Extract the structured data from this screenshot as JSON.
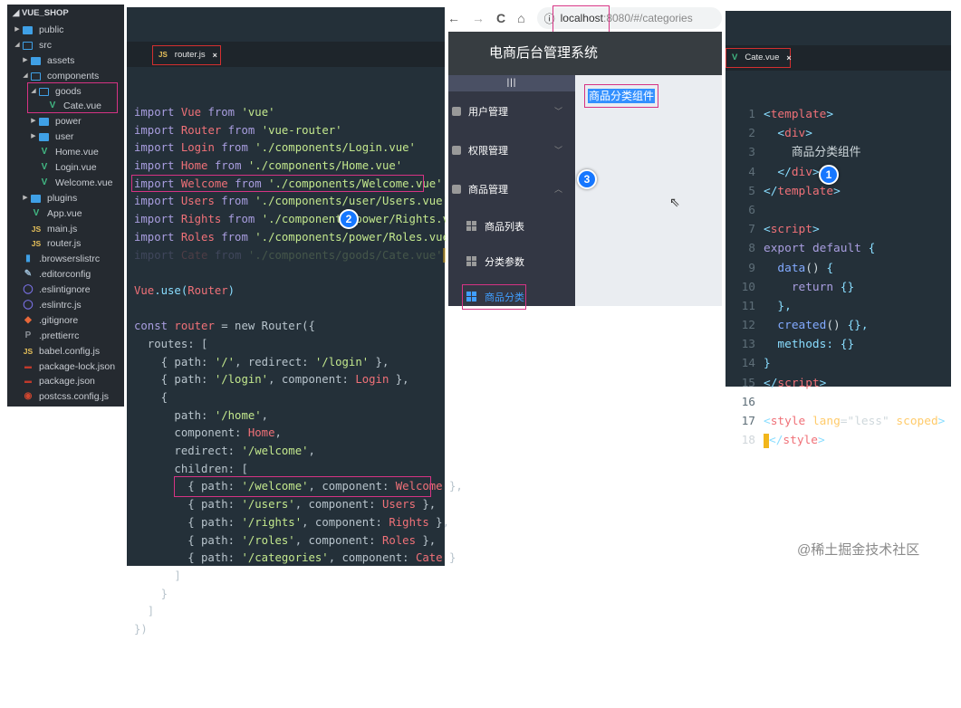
{
  "explorer": {
    "title": "VUE_SHOP",
    "items": [
      {
        "label": "public",
        "icon": "folder",
        "level": 1,
        "arrow": "▶"
      },
      {
        "label": "src",
        "icon": "folder-open",
        "level": 1,
        "arrow": "◢"
      },
      {
        "label": "assets",
        "icon": "folder",
        "level": 2,
        "arrow": "▶"
      },
      {
        "label": "components",
        "icon": "folder-open",
        "level": 2,
        "arrow": "◢"
      },
      {
        "label": "goods",
        "icon": "folder-open",
        "level": 3,
        "arrow": "◢"
      },
      {
        "label": "Cate.vue",
        "icon": "vue",
        "level": 4,
        "arrow": ""
      },
      {
        "label": "power",
        "icon": "folder",
        "level": 3,
        "arrow": "▶"
      },
      {
        "label": "user",
        "icon": "folder",
        "level": 3,
        "arrow": "▶"
      },
      {
        "label": "Home.vue",
        "icon": "vue",
        "level": 3,
        "arrow": ""
      },
      {
        "label": "Login.vue",
        "icon": "vue",
        "level": 3,
        "arrow": ""
      },
      {
        "label": "Welcome.vue",
        "icon": "vue",
        "level": 3,
        "arrow": ""
      },
      {
        "label": "plugins",
        "icon": "folder",
        "level": 2,
        "arrow": "▶"
      },
      {
        "label": "App.vue",
        "icon": "vue",
        "level": 2,
        "arrow": ""
      },
      {
        "label": "main.js",
        "icon": "js",
        "level": 2,
        "arrow": ""
      },
      {
        "label": "router.js",
        "icon": "js",
        "level": 2,
        "arrow": ""
      },
      {
        "label": ".browserslistrc",
        "icon": "file",
        "level": 1,
        "arrow": ""
      },
      {
        "label": ".editorconfig",
        "icon": "editorconfig",
        "level": 1,
        "arrow": ""
      },
      {
        "label": ".eslintignore",
        "icon": "eslint",
        "level": 1,
        "arrow": ""
      },
      {
        "label": ".eslintrc.js",
        "icon": "eslint",
        "level": 1,
        "arrow": ""
      },
      {
        "label": ".gitignore",
        "icon": "git",
        "level": 1,
        "arrow": ""
      },
      {
        "label": ".prettierrc",
        "icon": "prettier",
        "level": 1,
        "arrow": ""
      },
      {
        "label": "babel.config.js",
        "icon": "js",
        "level": 1,
        "arrow": ""
      },
      {
        "label": "package-lock.json",
        "icon": "npm",
        "level": 1,
        "arrow": ""
      },
      {
        "label": "package.json",
        "icon": "npm",
        "level": 1,
        "arrow": ""
      },
      {
        "label": "postcss.config.js",
        "icon": "postcss",
        "level": 1,
        "arrow": ""
      }
    ]
  },
  "router": {
    "tab_icon": "JS",
    "tab_label": "router.js",
    "close": "×",
    "badge": "2",
    "lines": [
      [
        [
          "import ",
          "k"
        ],
        [
          "Vue ",
          "v"
        ],
        [
          "from ",
          "k"
        ],
        [
          "'vue'",
          "s"
        ]
      ],
      [
        [
          "import ",
          "k"
        ],
        [
          "Router ",
          "v"
        ],
        [
          "from ",
          "k"
        ],
        [
          "'vue-router'",
          "s"
        ]
      ],
      [
        [
          "import ",
          "k"
        ],
        [
          "Login ",
          "v"
        ],
        [
          "from ",
          "k"
        ],
        [
          "'./components/Login.vue'",
          "s"
        ]
      ],
      [
        [
          "import ",
          "k"
        ],
        [
          "Home ",
          "v"
        ],
        [
          "from ",
          "k"
        ],
        [
          "'./components/Home.vue'",
          "s"
        ]
      ],
      [
        [
          "import ",
          "k"
        ],
        [
          "Welcome ",
          "v"
        ],
        [
          "from ",
          "k"
        ],
        [
          "'./components/Welcome.vue'",
          "s"
        ]
      ],
      [
        [
          "import ",
          "k"
        ],
        [
          "Users ",
          "v"
        ],
        [
          "from ",
          "k"
        ],
        [
          "'./components/user/Users.vue'",
          "s"
        ]
      ],
      [
        [
          "import ",
          "k"
        ],
        [
          "Rights ",
          "v"
        ],
        [
          "from ",
          "k"
        ],
        [
          "'./components/power/Rights.vue'",
          "s"
        ]
      ],
      [
        [
          "import ",
          "k"
        ],
        [
          "Roles ",
          "v"
        ],
        [
          "from ",
          "k"
        ],
        [
          "'./components/power/Roles.vue'",
          "s"
        ]
      ],
      [
        [
          "import ",
          "k"
        ],
        [
          "Cate ",
          "v"
        ],
        [
          "from ",
          "k"
        ],
        [
          "'./components/goods/Cate.vue'",
          "s"
        ]
      ],
      [],
      [
        [
          "Vue",
          "v"
        ],
        [
          ".use(",
          "p"
        ],
        [
          "Router",
          "v"
        ],
        [
          ")",
          "p"
        ]
      ],
      [],
      [
        [
          "const ",
          "k"
        ],
        [
          "router ",
          "v"
        ],
        [
          "= new Router({",
          "pl"
        ]
      ],
      [
        [
          "  routes: [",
          "pl"
        ]
      ],
      [
        [
          "    { path: ",
          "pl"
        ],
        [
          "'/'",
          "s"
        ],
        [
          ", redirect: ",
          "pl"
        ],
        [
          "'/login'",
          "s"
        ],
        [
          " },",
          "pl"
        ]
      ],
      [
        [
          "    { path: ",
          "pl"
        ],
        [
          "'/login'",
          "s"
        ],
        [
          ", component: ",
          "pl"
        ],
        [
          "Login",
          "v"
        ],
        [
          " },",
          "pl"
        ]
      ],
      [
        [
          "    {",
          "pl"
        ]
      ],
      [
        [
          "      path: ",
          "pl"
        ],
        [
          "'/home'",
          "s"
        ],
        [
          ",",
          "pl"
        ]
      ],
      [
        [
          "      component: ",
          "pl"
        ],
        [
          "Home",
          "v"
        ],
        [
          ",",
          "pl"
        ]
      ],
      [
        [
          "      redirect: ",
          "pl"
        ],
        [
          "'/welcome'",
          "s"
        ],
        [
          ",",
          "pl"
        ]
      ],
      [
        [
          "      children: [",
          "pl"
        ]
      ],
      [
        [
          "        { path: ",
          "pl"
        ],
        [
          "'/welcome'",
          "s"
        ],
        [
          ", component: ",
          "pl"
        ],
        [
          "Welcome",
          "v"
        ],
        [
          " },",
          "pl"
        ]
      ],
      [
        [
          "        { path: ",
          "pl"
        ],
        [
          "'/users'",
          "s"
        ],
        [
          ", component: ",
          "pl"
        ],
        [
          "Users",
          "v"
        ],
        [
          " },",
          "pl"
        ]
      ],
      [
        [
          "        { path: ",
          "pl"
        ],
        [
          "'/rights'",
          "s"
        ],
        [
          ", component: ",
          "pl"
        ],
        [
          "Rights",
          "v"
        ],
        [
          " },",
          "pl"
        ]
      ],
      [
        [
          "        { path: ",
          "pl"
        ],
        [
          "'/roles'",
          "s"
        ],
        [
          ", component: ",
          "pl"
        ],
        [
          "Roles",
          "v"
        ],
        [
          " },",
          "pl"
        ]
      ],
      [
        [
          "        { path: ",
          "pl"
        ],
        [
          "'/categories'",
          "s"
        ],
        [
          ", component: ",
          "pl"
        ],
        [
          "Cate",
          "v"
        ],
        [
          " }",
          "pl"
        ]
      ],
      [
        [
          "      ]",
          "pl"
        ]
      ],
      [
        [
          "    }",
          "pl"
        ]
      ],
      [
        [
          "  ]",
          "pl"
        ]
      ],
      [
        [
          "})",
          "pl"
        ]
      ]
    ]
  },
  "browser": {
    "back": "←",
    "forward": "→",
    "reload": "C",
    "home": "⌂",
    "info": "ⓘ",
    "url_host": "localhost",
    "url_rest": ":8080/#/categories",
    "app_title": "电商后台管理系统",
    "toggle": "|||",
    "menus": [
      {
        "label": "用户管理",
        "chevron": "﹀"
      },
      {
        "label": "权限管理",
        "chevron": "﹀"
      },
      {
        "label": "商品管理",
        "chevron": "︿"
      }
    ],
    "submenus": [
      {
        "label": "商品列表"
      },
      {
        "label": "分类参数"
      },
      {
        "label": "商品分类"
      }
    ],
    "content": "商品分类组件",
    "badge": "3"
  },
  "cate": {
    "tab_icon": "V",
    "tab_label": "Cate.vue",
    "close": "×",
    "badge": "1",
    "lines": [
      [
        [
          "<",
          "p"
        ],
        [
          "template",
          "t"
        ],
        [
          ">",
          "p"
        ]
      ],
      [
        [
          "  <",
          "p"
        ],
        [
          "div",
          "t"
        ],
        [
          ">",
          "p"
        ]
      ],
      [
        [
          "    商品分类组件",
          "w"
        ]
      ],
      [
        [
          "  </",
          "p"
        ],
        [
          "div",
          "t"
        ],
        [
          ">",
          "p"
        ]
      ],
      [
        [
          "</",
          "p"
        ],
        [
          "template",
          "t"
        ],
        [
          ">",
          "p"
        ]
      ],
      [],
      [
        [
          "<",
          "p"
        ],
        [
          "script",
          "t"
        ],
        [
          ">",
          "p"
        ]
      ],
      [
        [
          "export ",
          "k"
        ],
        [
          "default ",
          "k"
        ],
        [
          "{",
          "p"
        ]
      ],
      [
        [
          "  data",
          "f"
        ],
        [
          "() ",
          "w"
        ],
        [
          "{",
          "p"
        ]
      ],
      [
        [
          "    return ",
          "k"
        ],
        [
          "{}",
          "p"
        ]
      ],
      [
        [
          "  },",
          "p"
        ]
      ],
      [
        [
          "  created",
          "f"
        ],
        [
          "() ",
          "w"
        ],
        [
          "{},",
          "p"
        ]
      ],
      [
        [
          "  methods",
          "p"
        ],
        [
          ": {}",
          "p"
        ]
      ],
      [
        [
          "}",
          "p"
        ]
      ],
      [
        [
          "</",
          "p"
        ],
        [
          "script",
          "t"
        ],
        [
          ">",
          "p"
        ]
      ],
      [],
      [
        [
          "<",
          "p"
        ],
        [
          "style ",
          "t"
        ],
        [
          "lang",
          "a"
        ],
        [
          "=\"less\" ",
          "w"
        ],
        [
          "scoped",
          "a"
        ],
        [
          ">",
          "p"
        ]
      ],
      [
        [
          "</",
          "p"
        ],
        [
          "style",
          "t"
        ],
        [
          ">",
          "p"
        ]
      ]
    ]
  },
  "watermark": "@稀土掘金技术社区"
}
